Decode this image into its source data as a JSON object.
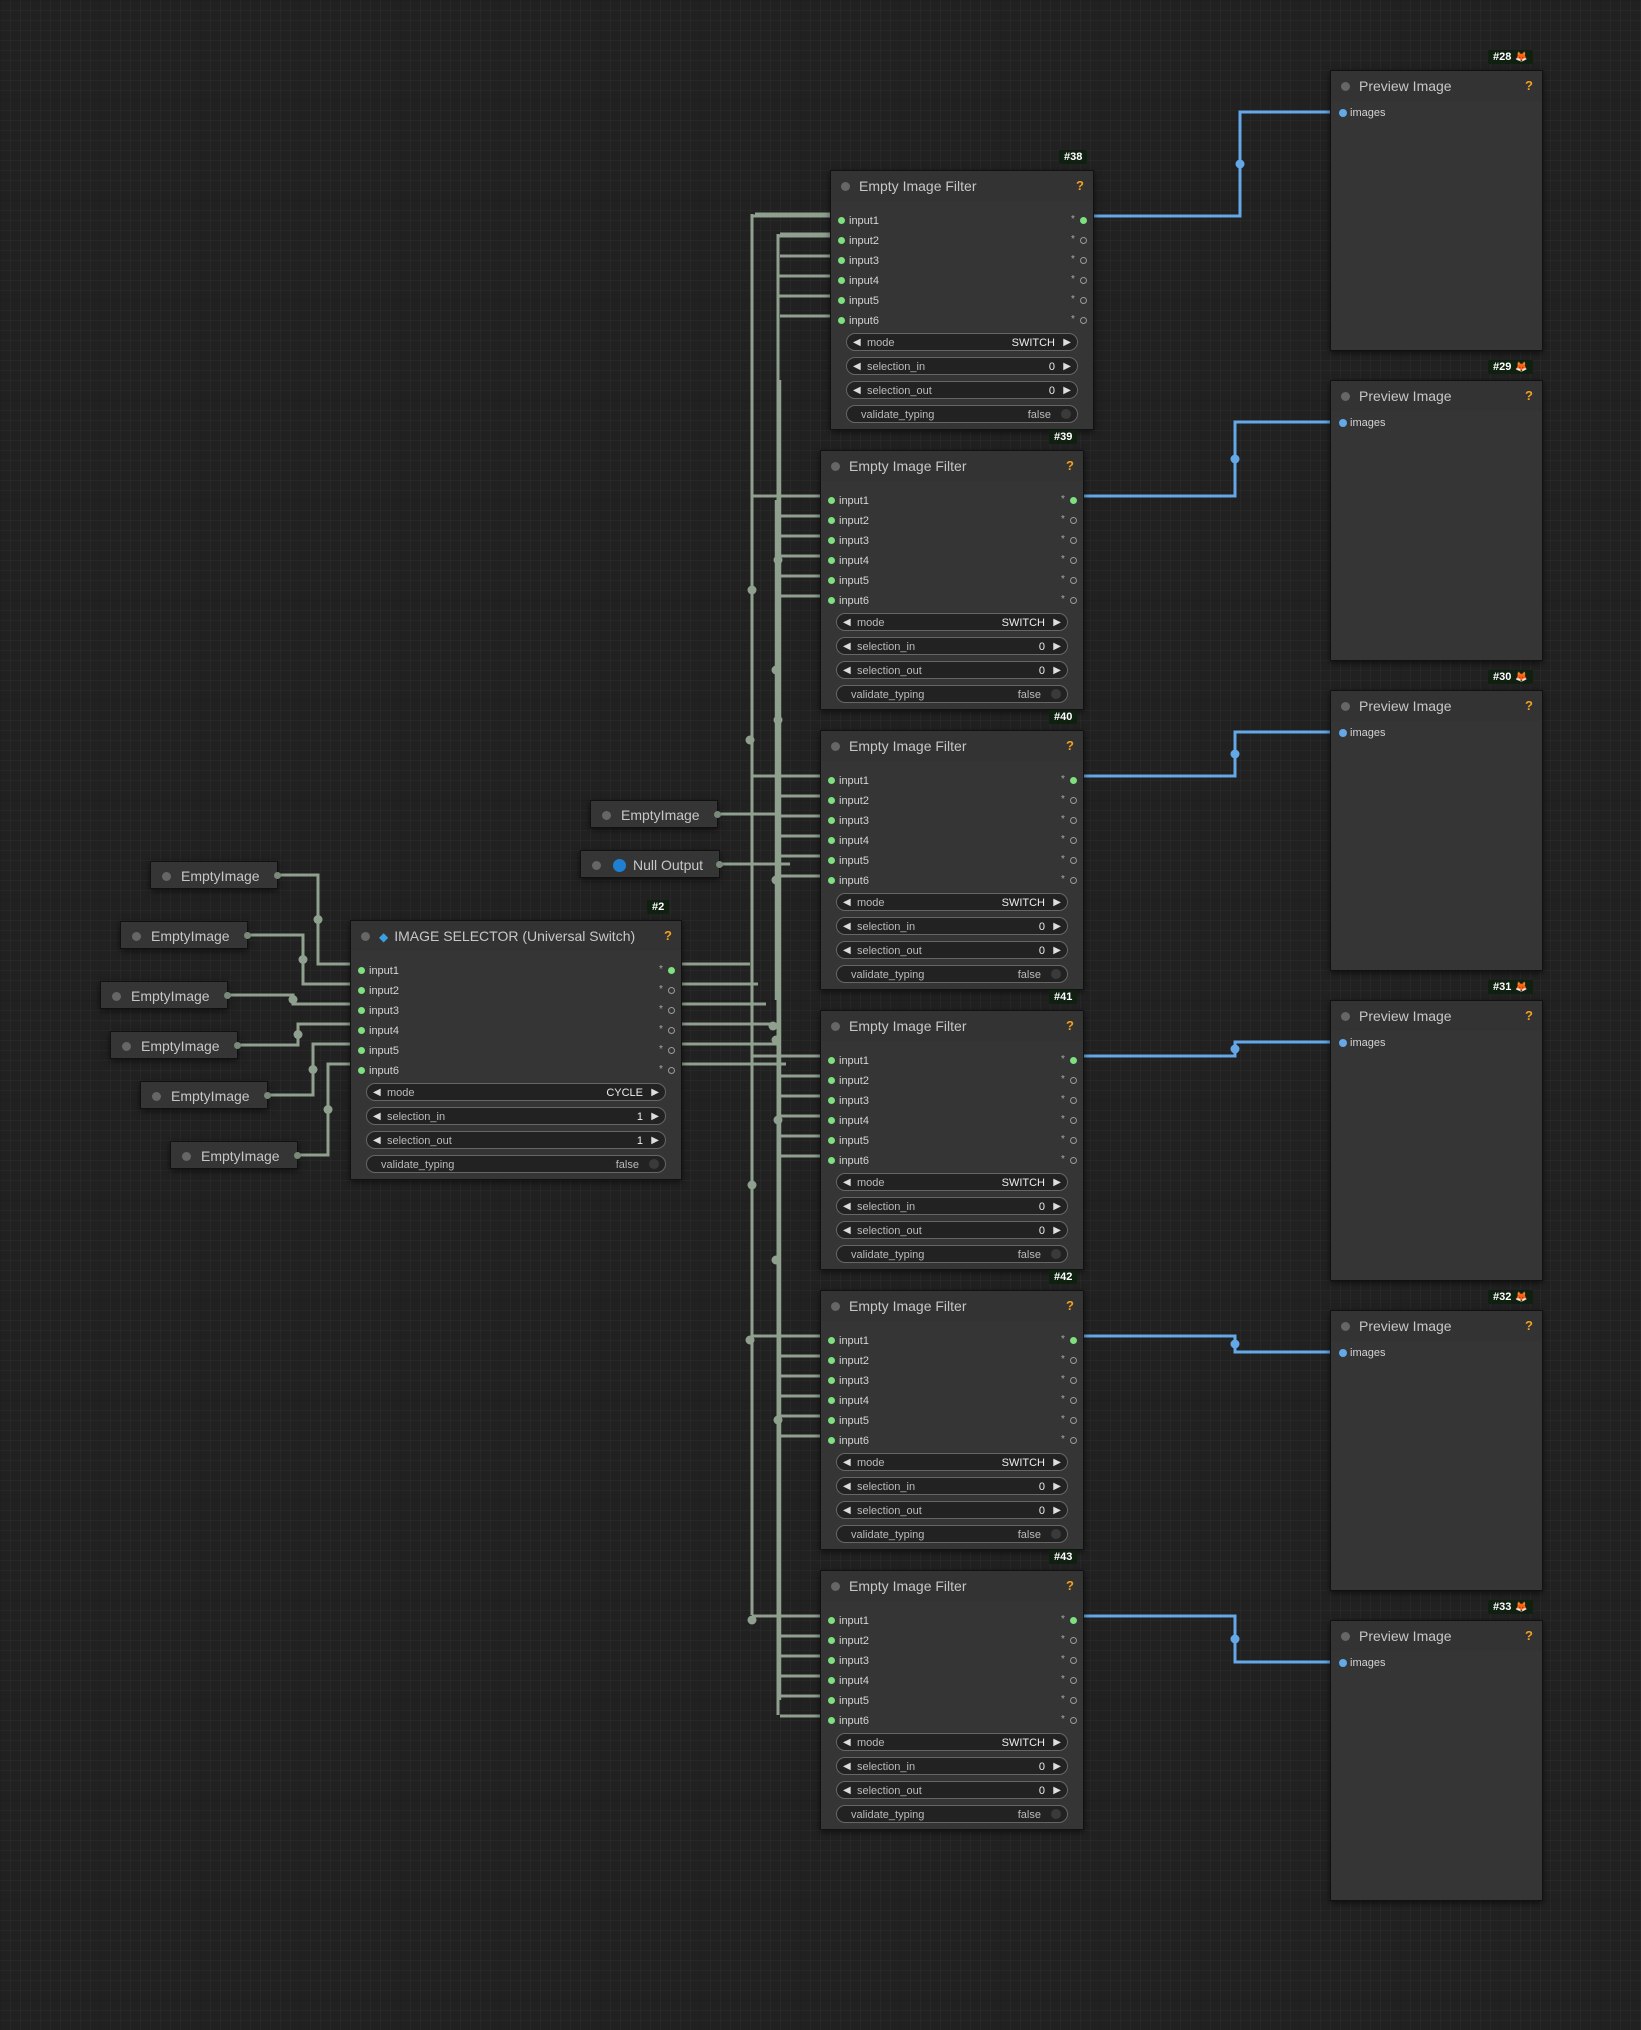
{
  "canvas": {
    "background": "#212121",
    "wire_color": "#8fa08f",
    "image_wire_color": "#64a8e8"
  },
  "empty_filter": {
    "title": "Empty Image Filter",
    "help": "?",
    "inputs": [
      "input1",
      "input2",
      "input3",
      "input4",
      "input5",
      "input6"
    ],
    "output_mark": "*",
    "widgets": {
      "mode_label": "mode",
      "mode_value": "SWITCH",
      "sel_in_label": "selection_in",
      "sel_in_value": "0",
      "sel_out_label": "selection_out",
      "sel_out_value": "0",
      "validate_label": "validate_typing",
      "validate_value": "false"
    },
    "nodes": [
      {
        "id": "#38"
      },
      {
        "id": "#39"
      },
      {
        "id": "#40"
      },
      {
        "id": "#41"
      },
      {
        "id": "#42"
      },
      {
        "id": "#43"
      }
    ]
  },
  "selector": {
    "id": "#2",
    "title": "IMAGE SELECTOR (Universal Switch)",
    "help": "?",
    "inputs": [
      "input1",
      "input2",
      "input3",
      "input4",
      "input5",
      "input6"
    ],
    "output_mark": "*",
    "widgets": {
      "mode_label": "mode",
      "mode_value": "CYCLE",
      "sel_in_label": "selection_in",
      "sel_in_value": "1",
      "sel_out_label": "selection_out",
      "sel_out_value": "1",
      "validate_label": "validate_typing",
      "validate_value": "false"
    }
  },
  "preview": {
    "title": "Preview Image",
    "help": "?",
    "input": "images",
    "badge_icon": "🦊",
    "nodes": [
      {
        "id": "#28"
      },
      {
        "id": "#29"
      },
      {
        "id": "#30"
      },
      {
        "id": "#31"
      },
      {
        "id": "#32"
      },
      {
        "id": "#33"
      }
    ]
  },
  "empty_image_label": "EmptyImage",
  "null_output_label": "Null Output"
}
